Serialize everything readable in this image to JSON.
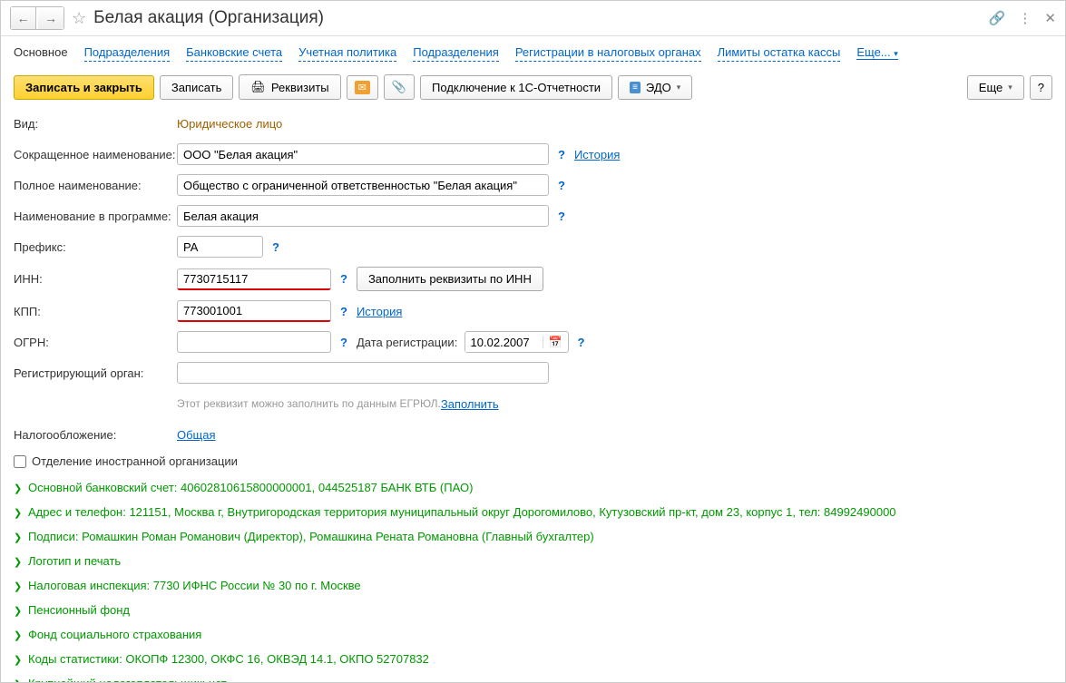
{
  "header": {
    "title": "Белая акация (Организация)"
  },
  "tabs": {
    "items": [
      {
        "label": "Основное",
        "active": true
      },
      {
        "label": "Подразделения"
      },
      {
        "label": "Банковские счета"
      },
      {
        "label": "Учетная политика"
      },
      {
        "label": "Подразделения"
      },
      {
        "label": "Регистрации в налоговых органах"
      },
      {
        "label": "Лимиты остатка кассы"
      }
    ],
    "more": "Еще..."
  },
  "toolbar": {
    "save_close": "Записать и закрыть",
    "save": "Записать",
    "requisites": "Реквизиты",
    "connect_1c": "Подключение к 1С-Отчетности",
    "edo": "ЭДО",
    "more": "Еще",
    "help": "?"
  },
  "form": {
    "type_label": "Вид:",
    "type_value": "Юридическое лицо",
    "short_name_label": "Сокращенное наименование:",
    "short_name_value": "ООО \"Белая акация\"",
    "history": "История",
    "full_name_label": "Полное наименование:",
    "full_name_value": "Общество с ограниченной ответственностью \"Белая акация\"",
    "prog_name_label": "Наименование в программе:",
    "prog_name_value": "Белая акация",
    "prefix_label": "Префикс:",
    "prefix_value": "РА",
    "inn_label": "ИНН:",
    "inn_value": "7730715117",
    "fill_by_inn": "Заполнить реквизиты по ИНН",
    "kpp_label": "КПП:",
    "kpp_value": "773001001",
    "ogrn_label": "ОГРН:",
    "ogrn_value": "",
    "reg_date_label": "Дата регистрации:",
    "reg_date_value": "10.02.2007",
    "reg_org_label": "Регистрирующий орган:",
    "reg_org_value": "",
    "hint_text": "Этот реквизит можно заполнить по данным ЕГРЮЛ. ",
    "fill_link": "Заполнить",
    "tax_label": "Налогообложение:",
    "tax_value": "Общая",
    "foreign_label": "Отделение иностранной организации"
  },
  "sections": [
    "Основной банковский счет: 40602810615800000001, 044525187 БАНК ВТБ (ПАО)",
    "Адрес и телефон: 121151, Москва г, Внутригородская территория муниципальный округ Дорогомилово, Кутузовский пр-кт, дом 23, корпус 1, тел: 84992490000",
    "Подписи: Ромашкин Роман Романович (Директор), Ромашкина Рената Романовна (Главный бухгалтер)",
    "Логотип и печать",
    "Налоговая инспекция: 7730 ИФНС России № 30 по г. Москве",
    "Пенсионный фонд",
    "Фонд социального страхования",
    "Коды статистики: ОКОПФ 12300, ОКФС 16, ОКВЭД 14.1, ОКПО 52707832",
    "Крупнейший налогоплательщик: нет"
  ]
}
